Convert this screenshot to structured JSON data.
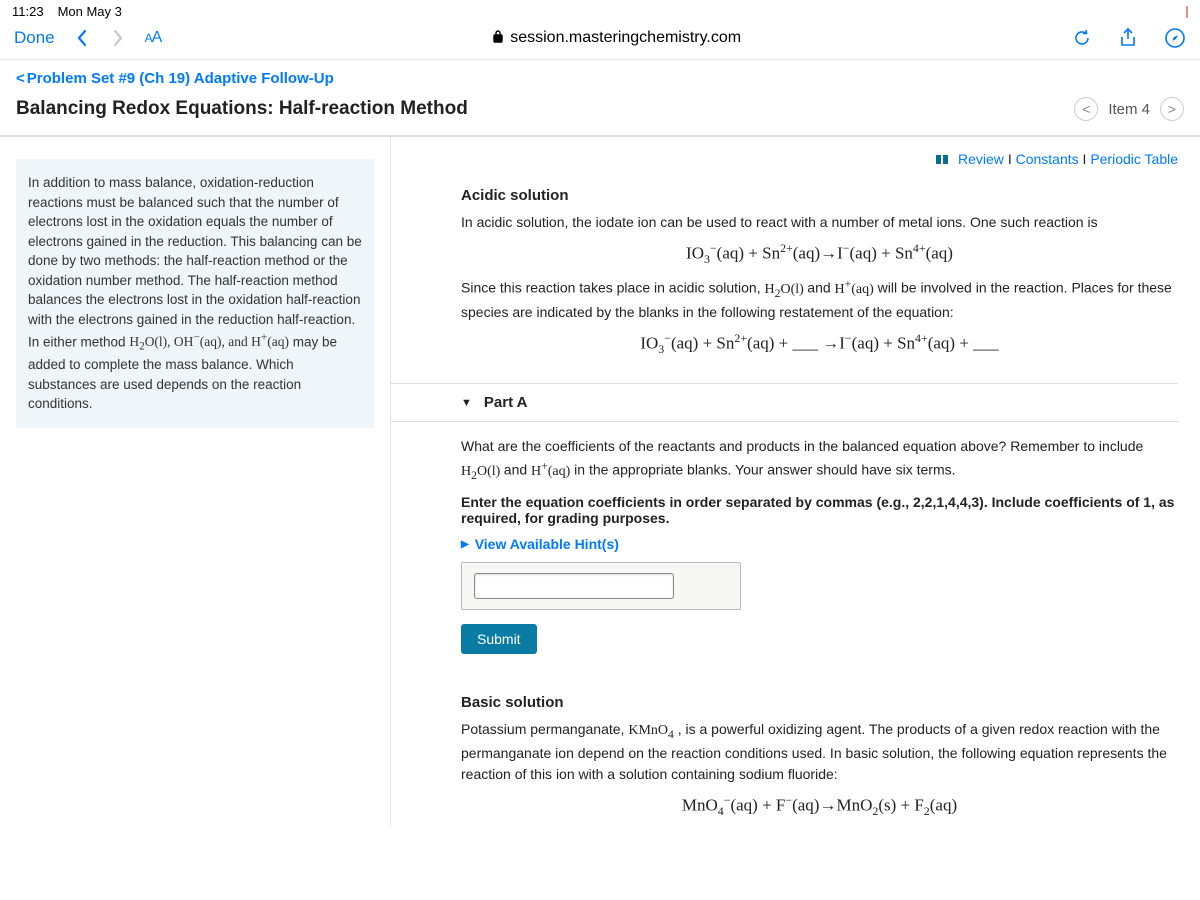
{
  "status": {
    "time": "11:23",
    "date": "Mon May 3"
  },
  "browser": {
    "done": "Done",
    "aa_small": "A",
    "aa_big": "A",
    "url": "session.masteringchemistry.com"
  },
  "nav": {
    "back_label": "Problem Set #9 (Ch 19) Adaptive Follow-Up",
    "title": "Balancing Redox Equations: Half-reaction Method",
    "item_label": "Item 4"
  },
  "toplinks": {
    "review": "Review",
    "constants": "Constants",
    "periodic": "Periodic Table",
    "sep": " I "
  },
  "intro": {
    "text_a": "In addition to mass balance, oxidation-reduction reactions must be balanced such that the number of electrons lost in the oxidation equals the number of electrons gained in the reduction. This balancing can be done by two methods: the half-reaction method or the oxidation number method. The half-reaction method balances the electrons lost in the oxidation half-reaction with the electrons gained in the reduction half-reaction. In either method ",
    "text_b": " may be added to complete the mass balance. Which substances are used depends on the reaction conditions."
  },
  "acidic": {
    "heading": "Acidic solution",
    "p1": "In acidic solution, the iodate ion can be used to react with a number of metal ions. One such reaction is",
    "p2a": "Since this reaction takes place in acidic solution, ",
    "p2b": " will be involved in the reaction. Places for these species are indicated by the blanks in the following restatement of the equation:"
  },
  "partA": {
    "label": "Part A",
    "q1a": "What are the coefficients of the reactants and products in the balanced equation above? Remember to include ",
    "q1b": " in the appropriate blanks. Your answer should have six terms.",
    "instr": "Enter the equation coefficients in order separated by commas (e.g., 2,2,1,4,4,3). Include coefficients of 1, as required, for grading purposes.",
    "hints": "View Available Hint(s)",
    "submit": "Submit"
  },
  "basic": {
    "heading": "Basic solution",
    "p1a": "Potassium permanganate, ",
    "p1b": " , is a powerful oxidizing agent. The products of a given redox reaction with the permanganate ion depend on the reaction conditions used. In basic solution, the following equation represents the reaction of this ion with a solution containing sodium fluoride:"
  }
}
